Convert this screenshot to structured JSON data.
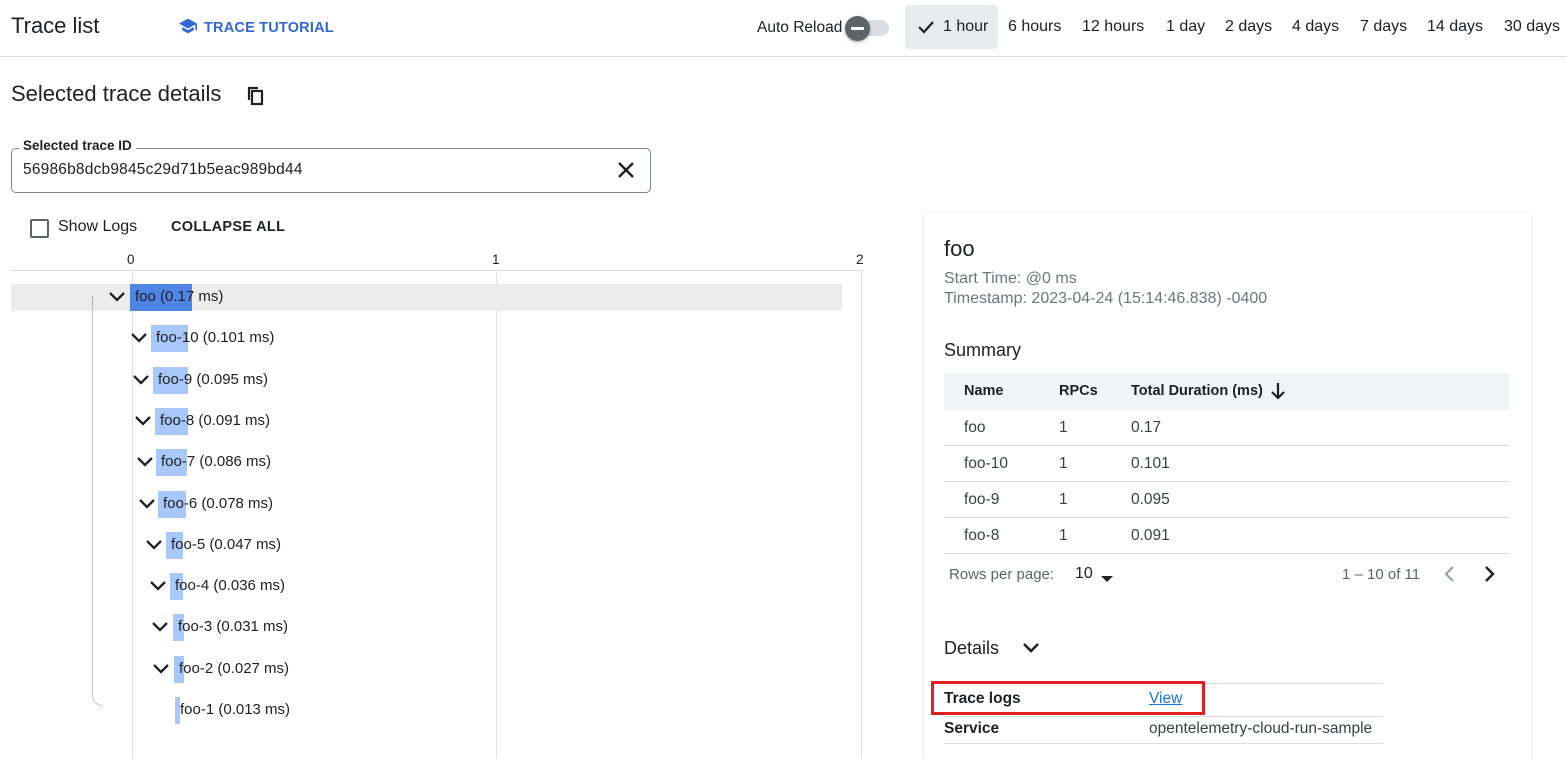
{
  "header": {
    "title": "Trace list",
    "tutorial_label": "TRACE TUTORIAL",
    "auto_reload_label": "Auto Reload",
    "auto_reload_on": false,
    "time_ranges": [
      "1 hour",
      "6 hours",
      "12 hours",
      "1 day",
      "2 days",
      "4 days",
      "7 days",
      "14 days",
      "30 days"
    ],
    "selected_range": "1 hour"
  },
  "details": {
    "title": "Selected trace details",
    "trace_id_label": "Selected trace ID",
    "trace_id_value": "56986b8dcb9845c29d71b5eac989bd44",
    "show_logs_label": "Show Logs",
    "collapse_all_label": "COLLAPSE ALL"
  },
  "timeline": {
    "axis_ticks": [
      "0",
      "1",
      "2"
    ],
    "spans": [
      {
        "label": "foo (0.17 ms)",
        "duration_ms": 0.17
      },
      {
        "label": "foo-10 (0.101 ms)",
        "duration_ms": 0.101
      },
      {
        "label": "foo-9 (0.095 ms)",
        "duration_ms": 0.095
      },
      {
        "label": "foo-8 (0.091 ms)",
        "duration_ms": 0.091
      },
      {
        "label": "foo-7 (0.086 ms)",
        "duration_ms": 0.086
      },
      {
        "label": "foo-6 (0.078 ms)",
        "duration_ms": 0.078
      },
      {
        "label": "foo-5 (0.047 ms)",
        "duration_ms": 0.047
      },
      {
        "label": "foo-4 (0.036 ms)",
        "duration_ms": 0.036
      },
      {
        "label": "foo-3 (0.031 ms)",
        "duration_ms": 0.031
      },
      {
        "label": "foo-2 (0.027 ms)",
        "duration_ms": 0.027
      },
      {
        "label": "foo-1 (0.013 ms)",
        "duration_ms": 0.013
      }
    ]
  },
  "panel": {
    "span_name": "foo",
    "start_time": "Start Time: @0 ms",
    "timestamp": "Timestamp: 2023-04-24 (15:14:46.838) -0400",
    "summary_title": "Summary",
    "columns": [
      "Name",
      "RPCs",
      "Total Duration (ms)"
    ],
    "rows": [
      {
        "name": "foo",
        "rpcs": "1",
        "duration": "0.17"
      },
      {
        "name": "foo-10",
        "rpcs": "1",
        "duration": "0.101"
      },
      {
        "name": "foo-9",
        "rpcs": "1",
        "duration": "0.095"
      },
      {
        "name": "foo-8",
        "rpcs": "1",
        "duration": "0.091"
      }
    ],
    "rows_per_page_label": "Rows per page:",
    "rows_per_page_value": "10",
    "page_range": "1 – 10 of 11",
    "details_title": "Details",
    "detail_items": [
      {
        "key": "Trace logs",
        "value": "View"
      },
      {
        "key": "Service",
        "value": "opentelemetry-cloud-run-sample"
      }
    ]
  }
}
